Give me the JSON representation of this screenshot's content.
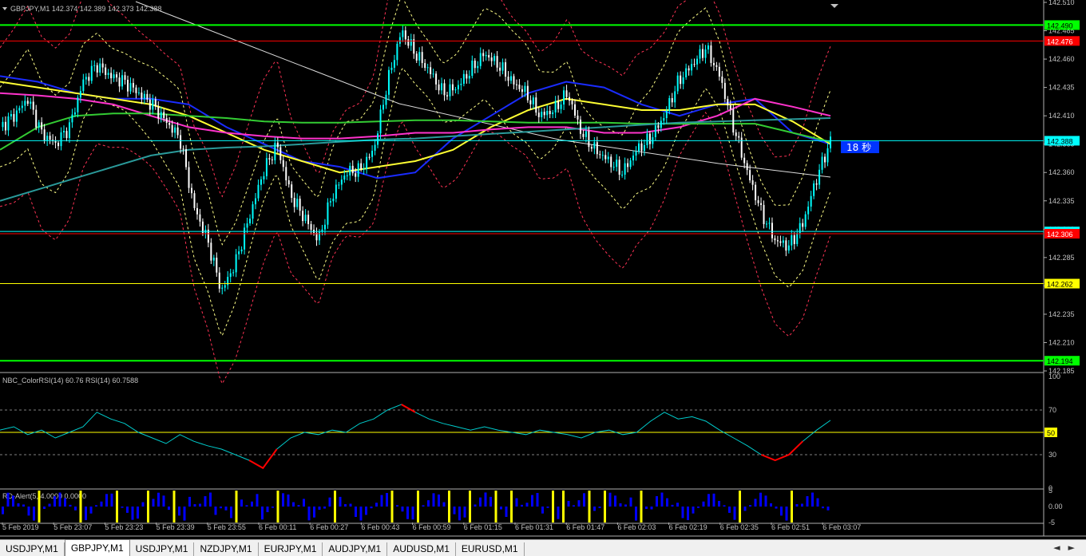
{
  "window": {
    "title": "GBPJPY,M1",
    "ohlc": "142.374 142.389 142.373 142.388"
  },
  "colors": {
    "background": "#000000",
    "bull": "#00ffff",
    "bear": "#ffffff",
    "ma_blue": "#1a2cff",
    "ma_yellow": "#ffff33",
    "ma_magenta": "#ff33cc",
    "ma_green": "#33cc33",
    "ma_teal": "#2a9a9a",
    "trend_white": "#dddddd",
    "band_yellow": "#ffff88",
    "band_red": "#ff3355",
    "hline_green": "#00ff00",
    "hline_red": "#ff0000",
    "hline_yellow": "#ffff00",
    "hline_cyan": "#00ffff",
    "rsi_line": "#00cccc",
    "rsi_hot": "#ff0000",
    "alert_blue": "#0000ff",
    "alert_yellow": "#ffff00"
  },
  "chart_data": [
    {
      "type": "candlestick",
      "title": "GBPJPY,M1",
      "price_range": [
        142.185,
        142.51
      ],
      "y_ticks": [
        "142.510",
        "142.485",
        "142.460",
        "142.435",
        "142.410",
        "142.385",
        "142.360",
        "142.335",
        "142.310",
        "142.285",
        "142.260",
        "142.235",
        "142.210",
        "142.185"
      ],
      "x_labels": [
        "5 Feb 2019",
        "5 Feb 23:07",
        "5 Feb 23:23",
        "5 Feb 23:39",
        "5 Feb 23:55",
        "6 Feb 00:11",
        "6 Feb 00:27",
        "6 Feb 00:43",
        "6 Feb 00:59",
        "6 Feb 01:15",
        "6 Feb 01:31",
        "6 Feb 01:47",
        "6 Feb 02:03",
        "6 Feb 02:19",
        "6 Feb 02:35",
        "6 Feb 02:51",
        "6 Feb 03:07"
      ],
      "close_path": [
        142.4,
        142.41,
        142.425,
        142.395,
        142.385,
        142.4,
        142.44,
        142.455,
        142.445,
        142.44,
        142.43,
        142.42,
        142.405,
        142.39,
        142.33,
        142.3,
        142.255,
        142.28,
        142.32,
        142.36,
        142.385,
        142.34,
        142.32,
        142.3,
        142.34,
        142.36,
        142.362,
        142.38,
        142.44,
        142.485,
        142.465,
        142.45,
        142.43,
        142.435,
        142.45,
        142.465,
        142.455,
        142.44,
        142.43,
        142.41,
        142.415,
        142.43,
        142.395,
        142.38,
        142.37,
        142.36,
        142.38,
        142.39,
        142.41,
        142.44,
        142.455,
        142.47,
        142.445,
        142.4,
        142.36,
        142.325,
        142.3,
        142.295,
        142.315,
        142.355,
        142.388
      ],
      "moving_averages": [
        {
          "color_key": "ma_blue",
          "values": [
            142.445,
            142.44,
            142.43,
            142.425,
            142.425,
            142.42,
            142.4,
            142.385,
            142.37,
            142.365,
            142.355,
            142.36,
            142.39,
            142.41,
            142.43,
            142.44,
            142.435,
            142.42,
            142.41,
            142.42,
            142.425,
            142.395,
            142.385
          ]
        },
        {
          "color_key": "ma_yellow",
          "values": [
            142.44,
            142.435,
            142.43,
            142.425,
            142.42,
            142.41,
            142.395,
            142.38,
            142.37,
            142.36,
            142.365,
            142.37,
            142.38,
            142.4,
            142.415,
            142.425,
            142.42,
            142.415,
            142.415,
            142.42,
            142.42,
            142.405,
            142.385
          ]
        },
        {
          "color_key": "ma_magenta",
          "values": [
            142.43,
            142.428,
            142.425,
            142.42,
            142.41,
            142.4,
            142.395,
            142.392,
            142.39,
            142.39,
            142.392,
            142.395,
            142.395,
            142.398,
            142.4,
            142.4,
            142.395,
            142.395,
            142.4,
            142.41,
            142.425,
            142.418,
            142.41
          ]
        },
        {
          "color_key": "ma_green",
          "values": [
            142.38,
            142.4,
            142.41,
            142.412,
            142.412,
            142.41,
            142.408,
            142.405,
            142.404,
            142.404,
            142.405,
            142.406,
            142.406,
            142.405,
            142.404,
            142.404,
            142.404,
            142.403,
            142.403,
            142.403,
            142.403,
            142.395,
            142.387
          ]
        },
        {
          "color_key": "ma_teal",
          "values": [
            142.335,
            142.345,
            142.355,
            142.365,
            142.375,
            142.38,
            142.382,
            142.383,
            142.385,
            142.387,
            142.389,
            142.39,
            142.392,
            142.394,
            142.396,
            142.398,
            142.4,
            142.402,
            142.404,
            142.405,
            142.406,
            142.407,
            142.408
          ]
        }
      ],
      "horizontal_lines": [
        {
          "price": 142.49,
          "label": "142.490",
          "color_key": "hline_green"
        },
        {
          "price": 142.476,
          "label": "142.476",
          "color_key": "hline_red"
        },
        {
          "price": 142.388,
          "label": "142.388",
          "color_key": "hline_cyan"
        },
        {
          "price": 142.308,
          "label": "142.308",
          "color_key": "hline_cyan"
        },
        {
          "price": 142.306,
          "label": "142.306",
          "color_key": "hline_red"
        },
        {
          "price": 142.262,
          "label": "142.262",
          "color_key": "hline_yellow"
        },
        {
          "price": 142.194,
          "label": "142.194",
          "color_key": "hline_green"
        }
      ],
      "countdown": "18 秒"
    },
    {
      "type": "line",
      "title": "NBC_ColorRSI(14) 60.76  RSI(14) 60.7588",
      "y_range": [
        0,
        100
      ],
      "y_ticks": [
        "100",
        "70",
        "50",
        "30",
        "0"
      ],
      "levels": [
        70,
        50,
        30
      ],
      "level_50_label": "50",
      "values": [
        52,
        55,
        48,
        52,
        45,
        50,
        55,
        68,
        62,
        58,
        50,
        45,
        40,
        48,
        42,
        38,
        35,
        30,
        25,
        18,
        35,
        45,
        50,
        48,
        52,
        50,
        58,
        62,
        70,
        75,
        68,
        62,
        58,
        55,
        52,
        55,
        52,
        50,
        48,
        52,
        50,
        48,
        45,
        50,
        52,
        48,
        50,
        60,
        68,
        62,
        64,
        60,
        52,
        45,
        38,
        30,
        25,
        30,
        42,
        52,
        60.76
      ],
      "hot_ranges": [
        [
          18,
          20
        ],
        [
          29,
          30
        ],
        [
          55,
          58
        ]
      ]
    },
    {
      "type": "bar",
      "title": "RD-Alert(5,  4.0000  0.0000",
      "y_range": [
        -5,
        5
      ],
      "y_ticks": [
        "5",
        "0.00",
        "-5"
      ],
      "yellow_at": [
        7,
        15,
        22,
        28,
        33,
        45,
        53,
        64,
        75,
        80,
        86,
        90,
        95,
        98,
        106,
        108,
        113,
        116,
        123,
        142,
        152
      ]
    }
  ],
  "tabs": [
    "USDJPY,M1",
    "GBPJPY,M1",
    "USDJPY,M1",
    "NZDJPY,M1",
    "EURJPY,M1",
    "AUDJPY,M1",
    "AUDUSD,M1",
    "EURUSD,M1"
  ],
  "active_tab": 1
}
